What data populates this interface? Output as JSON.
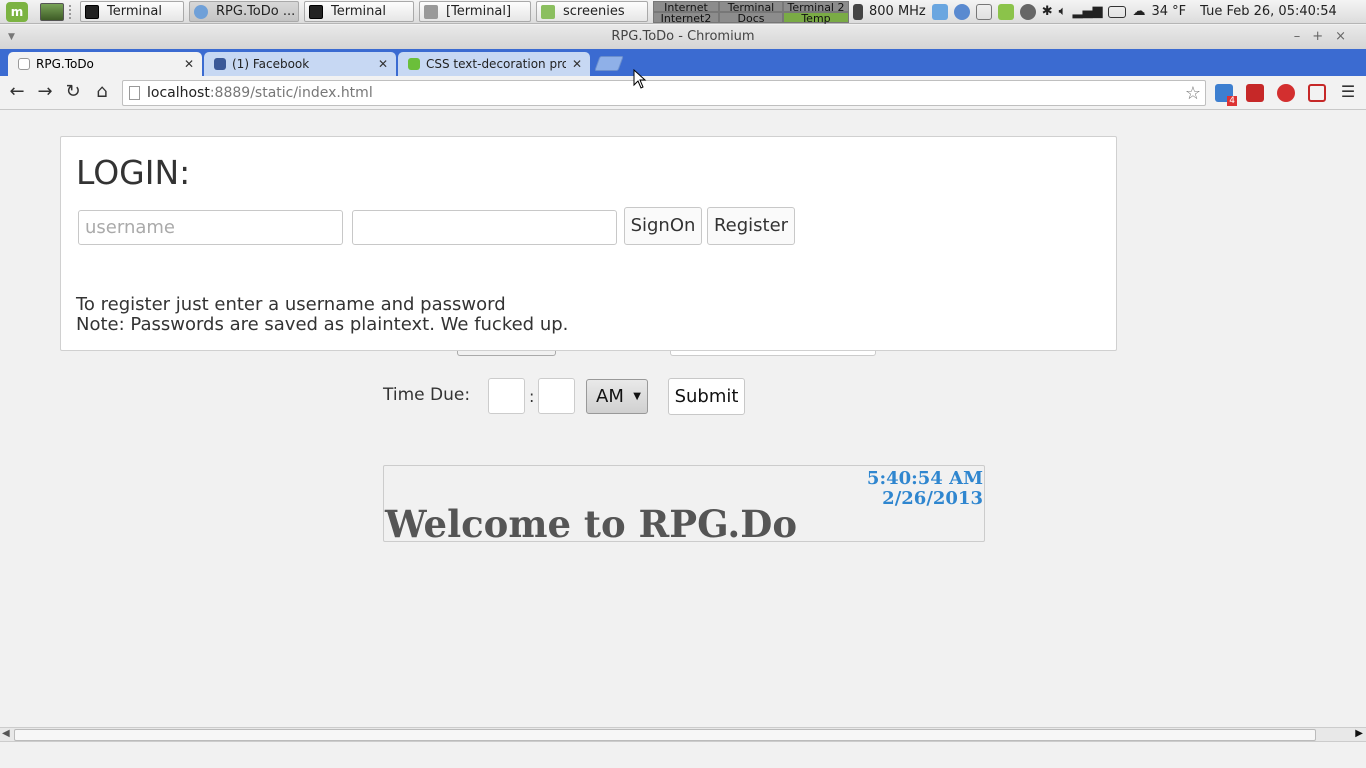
{
  "panel": {
    "tasks": [
      {
        "label": "Terminal",
        "icon": "terminal-icon"
      },
      {
        "label": "RPG.ToDo ...",
        "icon": "chromium-icon"
      },
      {
        "label": "Terminal",
        "icon": "terminal-icon"
      },
      {
        "label": "[Terminal]",
        "icon": "terminal-icon"
      },
      {
        "label": "screenies",
        "icon": "folder-icon"
      }
    ],
    "workspaces": [
      "Internet",
      "Terminal",
      "Terminal 2",
      "Internet2",
      "Docs",
      "Temp"
    ],
    "cpu_freq": "800 MHz",
    "weather": "34 °F",
    "clock": "Tue Feb 26, 05:40:54"
  },
  "window": {
    "title": "RPG.ToDo - Chromium",
    "tabs": [
      {
        "label": "RPG.ToDo"
      },
      {
        "label": "(1) Facebook"
      },
      {
        "label": "CSS text-decoration pro"
      }
    ]
  },
  "address": {
    "host": "localhost",
    "path": ":8889/static/index.html",
    "ext_badge": "4"
  },
  "login": {
    "heading": "LOGIN:",
    "username_placeholder": "username",
    "signon_label": "SignOn",
    "register_label": "Register",
    "note_line1": "To register just enter a username and password",
    "note_line2": "Note: Passwords are saved as plaintext. We fucked up."
  },
  "form": {
    "time_due_label": "Time Due:",
    "colon": ":",
    "ampm_value": "AM",
    "submit_label": "Submit"
  },
  "welcome": {
    "time": "5:40:54 AM",
    "date": "2/26/2013",
    "heading": "Welcome to RPG.Do"
  },
  "colors": {
    "tabstrip": "#3b6bd1",
    "clock": "#2f86cf",
    "mint": "#7cb342"
  }
}
